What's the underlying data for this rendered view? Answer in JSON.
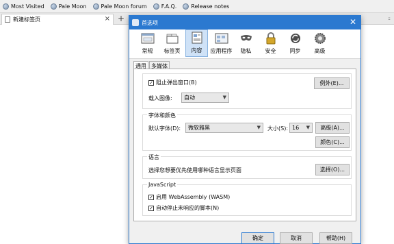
{
  "bookmarks": [
    "Most Visited",
    "Pale Moon",
    "Pale Moon forum",
    "F.A.Q.",
    "Release notes"
  ],
  "tab": {
    "title": "新建标签页",
    "close": "×",
    "new_tab": "+",
    "grip": "::"
  },
  "dialog": {
    "title": "首选项",
    "close": "✕",
    "panes": [
      {
        "label": "常规",
        "icon": "general-icon"
      },
      {
        "label": "标签页",
        "icon": "tabs-icon"
      },
      {
        "label": "内容",
        "icon": "content-icon",
        "selected": true
      },
      {
        "label": "应用程序",
        "icon": "applications-icon"
      },
      {
        "label": "隐私",
        "icon": "privacy-mask-icon"
      },
      {
        "label": "安全",
        "icon": "lock-icon"
      },
      {
        "label": "同步",
        "icon": "sync-icon"
      },
      {
        "label": "高级",
        "icon": "gear-icon"
      }
    ],
    "subtabs": [
      "通用",
      "多媒体"
    ],
    "popups": {
      "label": "阻止弹出窗口(B)",
      "checked": true,
      "exceptions": "例外(E)..."
    },
    "images": {
      "label": "载入图像:",
      "value": "自动"
    },
    "fonts": {
      "group": "字体和颜色",
      "default_label": "默认字体(D):",
      "default_value": "微软雅黑",
      "size_label": "大小(S):",
      "size_value": "16",
      "advanced": "高级(A)...",
      "colors": "颜色(C)..."
    },
    "language": {
      "group": "语言",
      "text": "选择您想要优先使用哪种语言显示页面",
      "choose": "选择(O)..."
    },
    "javascript": {
      "group": "JavaScript",
      "wasm": "启用 WebAssembly (WASM)",
      "wasm_checked": true,
      "stop_unresponsive": "自动停止未响应的脚本(N)",
      "stop_checked": true
    },
    "buttons": {
      "ok": "确定",
      "cancel": "取消",
      "help": "帮助(H)"
    }
  }
}
